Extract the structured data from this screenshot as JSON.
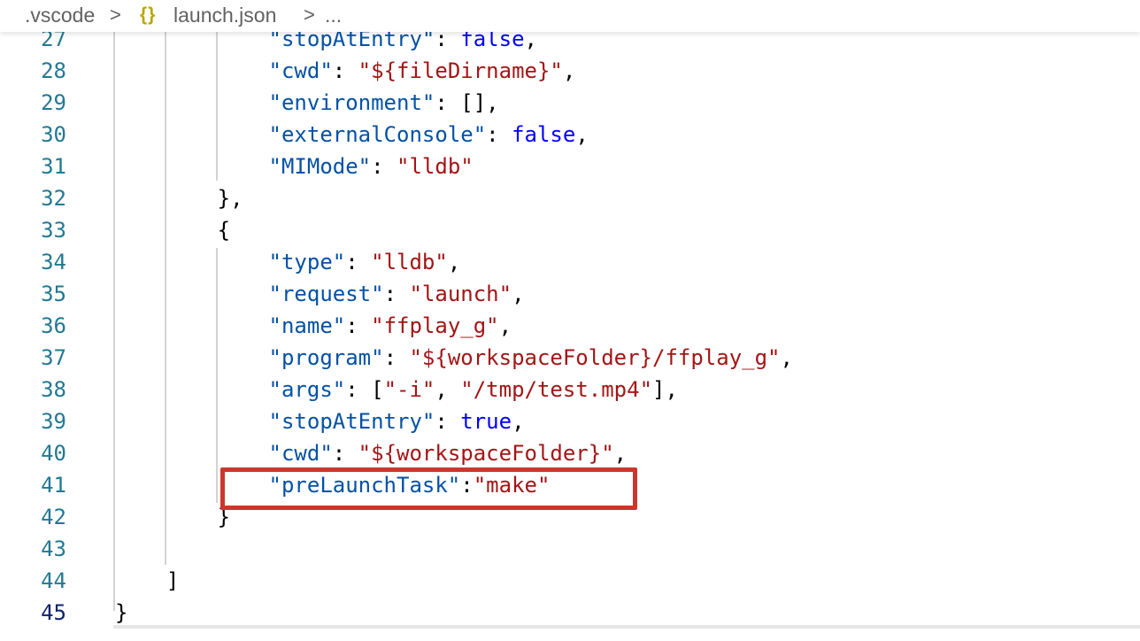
{
  "breadcrumb": {
    "folder": ".vscode",
    "separator": ">",
    "file_icon": "{}",
    "file": "launch.json",
    "more": "..."
  },
  "editor": {
    "active_line": "45",
    "lines": [
      {
        "n": "27",
        "tokens": [
          {
            "t": "\"stopAtEntry\"",
            "c": "k"
          },
          {
            "t": ": ",
            "c": "p"
          },
          {
            "t": "false",
            "c": "b"
          },
          {
            "t": ",",
            "c": "p"
          }
        ]
      },
      {
        "n": "28",
        "tokens": [
          {
            "t": "\"cwd\"",
            "c": "k"
          },
          {
            "t": ": ",
            "c": "p"
          },
          {
            "t": "\"${fileDirname}\"",
            "c": "s"
          },
          {
            "t": ",",
            "c": "p"
          }
        ]
      },
      {
        "n": "29",
        "tokens": [
          {
            "t": "\"environment\"",
            "c": "k"
          },
          {
            "t": ": [],",
            "c": "p"
          }
        ]
      },
      {
        "n": "30",
        "tokens": [
          {
            "t": "\"externalConsole\"",
            "c": "k"
          },
          {
            "t": ": ",
            "c": "p"
          },
          {
            "t": "false",
            "c": "b"
          },
          {
            "t": ",",
            "c": "p"
          }
        ]
      },
      {
        "n": "31",
        "tokens": [
          {
            "t": "\"MIMode\"",
            "c": "k"
          },
          {
            "t": ": ",
            "c": "p"
          },
          {
            "t": "\"lldb\"",
            "c": "s"
          }
        ]
      },
      {
        "n": "32",
        "tokens": [
          {
            "t": "},",
            "c": "p"
          }
        ]
      },
      {
        "n": "33",
        "tokens": [
          {
            "t": "{",
            "c": "p"
          }
        ]
      },
      {
        "n": "34",
        "tokens": [
          {
            "t": "\"type\"",
            "c": "k"
          },
          {
            "t": ": ",
            "c": "p"
          },
          {
            "t": "\"lldb\"",
            "c": "s"
          },
          {
            "t": ",",
            "c": "p"
          }
        ]
      },
      {
        "n": "35",
        "tokens": [
          {
            "t": "\"request\"",
            "c": "k"
          },
          {
            "t": ": ",
            "c": "p"
          },
          {
            "t": "\"launch\"",
            "c": "s"
          },
          {
            "t": ",",
            "c": "p"
          }
        ]
      },
      {
        "n": "36",
        "tokens": [
          {
            "t": "\"name\"",
            "c": "k"
          },
          {
            "t": ": ",
            "c": "p"
          },
          {
            "t": "\"ffplay_g\"",
            "c": "s"
          },
          {
            "t": ",",
            "c": "p"
          }
        ]
      },
      {
        "n": "37",
        "tokens": [
          {
            "t": "\"program\"",
            "c": "k"
          },
          {
            "t": ": ",
            "c": "p"
          },
          {
            "t": "\"${workspaceFolder}/ffplay_g\"",
            "c": "s"
          },
          {
            "t": ",",
            "c": "p"
          }
        ]
      },
      {
        "n": "38",
        "tokens": [
          {
            "t": "\"args\"",
            "c": "k"
          },
          {
            "t": ": [",
            "c": "p"
          },
          {
            "t": "\"-i\"",
            "c": "s"
          },
          {
            "t": ", ",
            "c": "p"
          },
          {
            "t": "\"/tmp/test.mp4\"",
            "c": "s"
          },
          {
            "t": "],",
            "c": "p"
          }
        ]
      },
      {
        "n": "39",
        "tokens": [
          {
            "t": "\"stopAtEntry\"",
            "c": "k"
          },
          {
            "t": ": ",
            "c": "p"
          },
          {
            "t": "true",
            "c": "b"
          },
          {
            "t": ",",
            "c": "p"
          }
        ]
      },
      {
        "n": "40",
        "tokens": [
          {
            "t": "\"cwd\"",
            "c": "k"
          },
          {
            "t": ": ",
            "c": "p"
          },
          {
            "t": "\"${workspaceFolder}\"",
            "c": "s"
          },
          {
            "t": ",",
            "c": "p"
          }
        ]
      },
      {
        "n": "41",
        "tokens": [
          {
            "t": "\"preLaunchTask\"",
            "c": "k"
          },
          {
            "t": ":",
            "c": "p"
          },
          {
            "t": "\"make\"",
            "c": "s"
          }
        ]
      },
      {
        "n": "42",
        "tokens": [
          {
            "t": "}",
            "c": "p"
          }
        ]
      },
      {
        "n": "43",
        "tokens": []
      },
      {
        "n": "44",
        "tokens": [
          {
            "t": "]",
            "c": "p"
          }
        ]
      },
      {
        "n": "45",
        "tokens": [
          {
            "t": "}",
            "c": "p"
          }
        ]
      }
    ]
  },
  "colors": {
    "json_key": "#0451a5",
    "json_string": "#a31515",
    "json_keyword": "#0000ff",
    "line_number": "#237893",
    "highlight_box": "#c9382c"
  }
}
